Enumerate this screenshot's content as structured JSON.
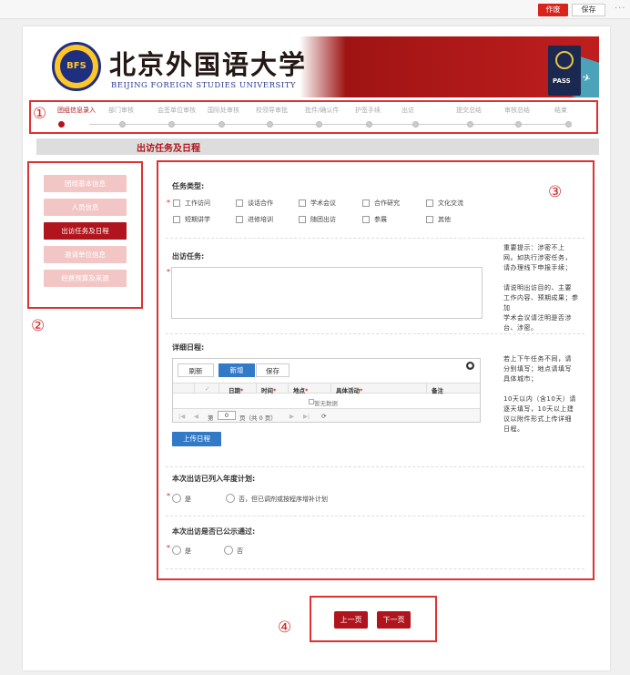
{
  "toolbar": {
    "void_label": "作废",
    "save_label": "保存",
    "more_label": "···"
  },
  "header": {
    "university_cn": "北京外国语大学",
    "university_en": "BEIJING FOREIGN STUDIES UNIVERSITY",
    "logo_text": "BFS",
    "pass_text": "PASS"
  },
  "steps": [
    {
      "label": "团组信息录入",
      "active": true
    },
    {
      "label": "部门审核",
      "active": false
    },
    {
      "label": "会签单位审核",
      "active": false
    },
    {
      "label": "国际处审核",
      "active": false
    },
    {
      "label": "校领导审批",
      "active": false
    },
    {
      "label": "批件/确认件",
      "active": false
    },
    {
      "label": "护签手续",
      "active": false
    },
    {
      "label": "出访",
      "active": false
    },
    {
      "label": "提交总结",
      "active": false
    },
    {
      "label": "审核总结",
      "active": false
    },
    {
      "label": "结束",
      "active": false
    }
  ],
  "section_title": "出访任务及日程",
  "sidebar": {
    "items": [
      {
        "label": "团组基本信息",
        "active": false
      },
      {
        "label": "人员信息",
        "active": false
      },
      {
        "label": "出访任务及日程",
        "active": true
      },
      {
        "label": "邀请单位信息",
        "active": false
      },
      {
        "label": "经费预算及来源",
        "active": false
      }
    ]
  },
  "form": {
    "task_type_label": "任务类型:",
    "task_types": [
      "工作访问",
      "谈话合作",
      "学术会议",
      "合作研究",
      "文化交流",
      "短期讲学",
      "进修培训",
      "随团出访",
      "参展",
      "其他"
    ],
    "mission_label": "出访任务:",
    "mission_hint": [
      "重要提示：涉密不上",
      "网。如执行涉密任务，",
      "请办理线下申报手续；",
      "",
      "请说明出访目的、主要",
      "工作内容、预期成果；参加",
      "学术会议请注明是否涉",
      "台、涉密。"
    ],
    "schedule_label": "详细日程:",
    "schedule_hint": [
      "若上下午任务不同，请",
      "分别填写；地点请填写",
      "具体城市；",
      "",
      "10天以内（含10天）请",
      "逐天填写，10天以上建",
      "议以附件形式上传详细",
      "日程。"
    ],
    "grid": {
      "refresh_label": "刷新",
      "add_label": "新增",
      "save_label": "保存",
      "columns": [
        "日期",
        "时间",
        "地点",
        "具体活动",
        "备注"
      ],
      "empty_text": "暂无数据",
      "pager": {
        "page_prefix": "第",
        "page_value": "0",
        "page_suffix": "页（共 0 页）"
      }
    },
    "upload_label": "上传日程",
    "plan_label": "本次出访已列入年度计划:",
    "plan_options": [
      "是",
      "否，但已调剂或按程序增补计划"
    ],
    "publicity_label": "本次出访是否已公示通过:",
    "publicity_options": [
      "是",
      "否"
    ]
  },
  "nav": {
    "prev_label": "上一页",
    "next_label": "下一页"
  },
  "annotations": [
    "①",
    "②",
    "③",
    "④"
  ],
  "colors": {
    "accent": "#b0141c",
    "annotation": "#e03030",
    "primary_blue": "#3279c8"
  }
}
